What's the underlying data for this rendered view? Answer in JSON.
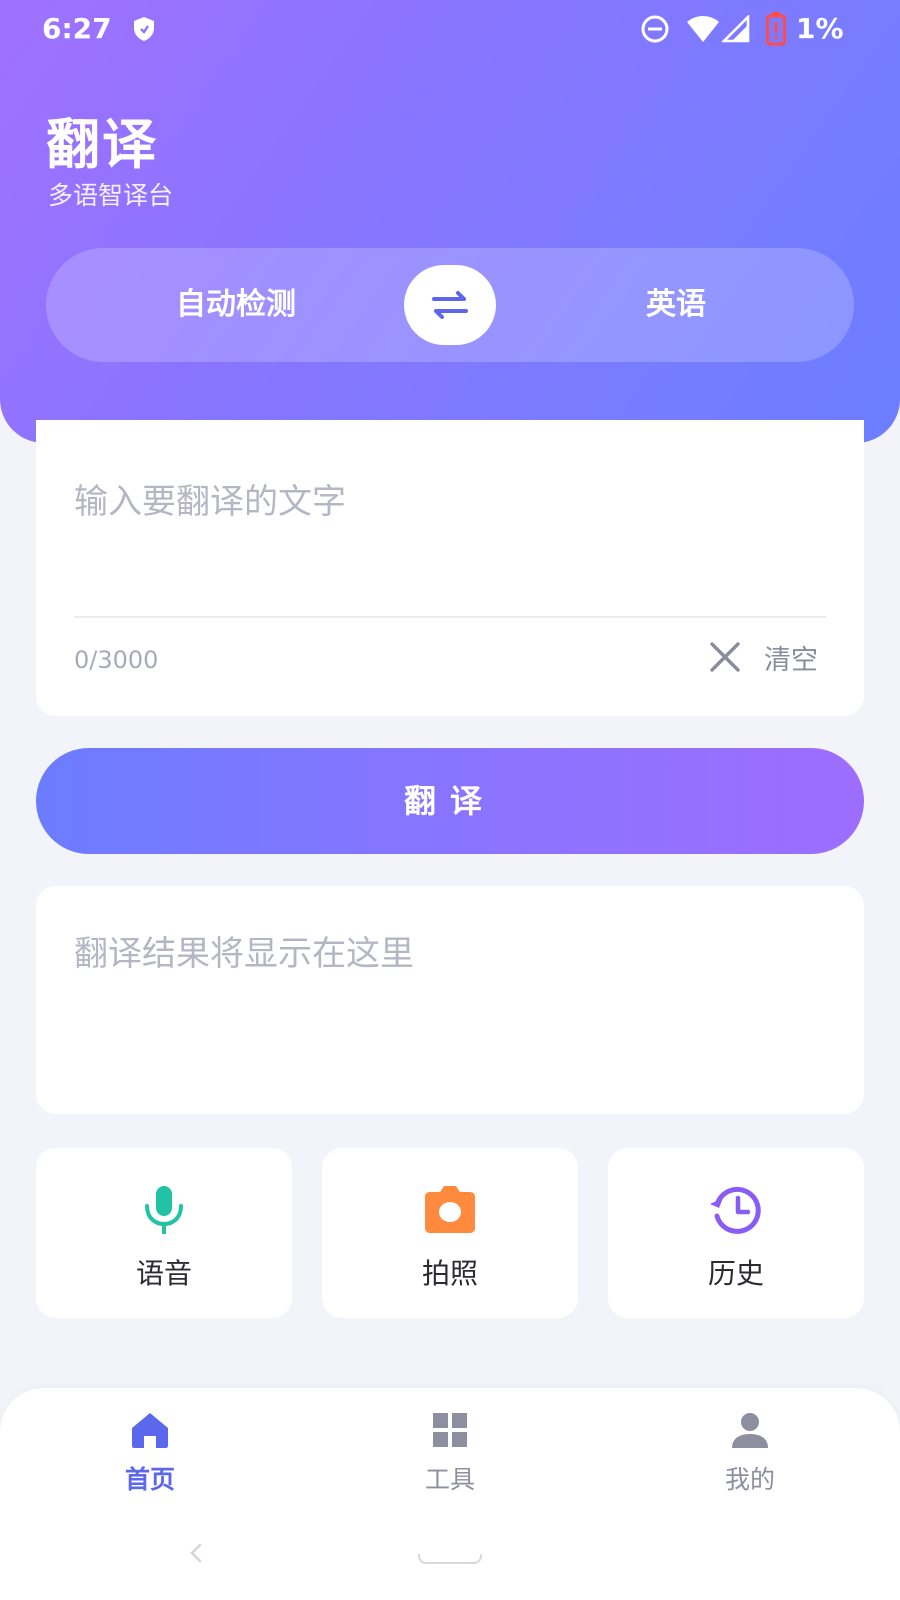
{
  "status_bar": {
    "time": "6:27",
    "battery_percent": "1%",
    "icons": [
      "shield-icon",
      "dnd-icon",
      "wifi-icon",
      "signal-icon",
      "battery-low-icon"
    ]
  },
  "header": {
    "title": "翻译",
    "subtitle": "多语智译台"
  },
  "language_bar": {
    "source": "自动检测",
    "target": "英语",
    "swap_icon": "swap-arrows-icon"
  },
  "input": {
    "placeholder": "输入要翻译的文字",
    "char_count": "0/3000",
    "clear_label": "清空"
  },
  "translate_button": {
    "label": "翻译"
  },
  "result": {
    "placeholder": "翻译结果将显示在这里"
  },
  "tools": [
    {
      "label": "语音",
      "icon": "microphone-icon",
      "color": "#22c3a5"
    },
    {
      "label": "拍照",
      "icon": "camera-icon",
      "color": "#ff8a3d"
    },
    {
      "label": "历史",
      "icon": "history-icon",
      "color": "#8a5cf6"
    }
  ],
  "bottom_nav": [
    {
      "label": "首页",
      "icon": "home-icon",
      "active": true
    },
    {
      "label": "工具",
      "icon": "grid-icon",
      "active": false
    },
    {
      "label": "我的",
      "icon": "user-icon",
      "active": false
    }
  ],
  "colors": {
    "accent": "#5b68ec",
    "header_gradient_start": "#a071ff",
    "header_gradient_end": "#6b7dff",
    "background": "#f3f3fa"
  }
}
